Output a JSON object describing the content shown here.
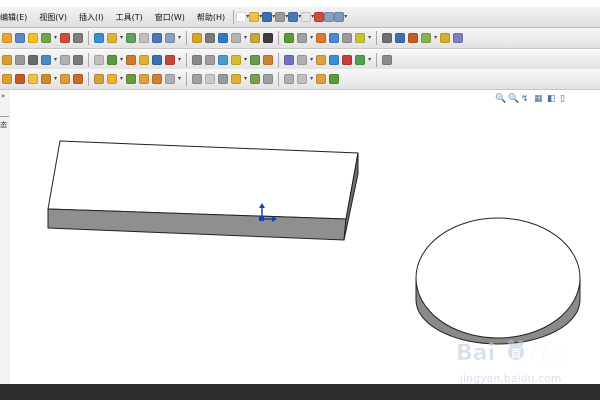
{
  "menubar": {
    "items": [
      "编辑(E)",
      "视图(V)",
      "插入(I)",
      "工具(T)",
      "窗口(W)",
      "帮助(H)"
    ]
  },
  "toolbar1": {
    "icons": [
      "#f0a030",
      "#5b87c7",
      "#f3c21b",
      "#6ea84a",
      "#d04a3a",
      "#7e7e7e",
      "#3a8fd0",
      "#e2b13a",
      "#60a060",
      "#c0c0c0",
      "#4a77b5",
      "#8aa0c0",
      "#d9a32a",
      "#7a7a7a",
      "#2e7cc0",
      "#b5b5b5",
      "#c8a73a",
      "#3c3c3c",
      "#5a9a3a",
      "#a0a0a0",
      "#d77a2a",
      "#4b8ad3",
      "#9b9b9b",
      "#c9c32e",
      "#6f6f6f",
      "#3a6fb0",
      "#c95a2a",
      "#8bb34a",
      "#d5b02e",
      "#8080c0"
    ]
  },
  "toolbar2": {
    "icons": [
      "#d8a02a",
      "#9a9a9a",
      "#6a6a6a",
      "#4a8bc5",
      "#b0b0b0",
      "#7a7a7a",
      "#c0c0c0",
      "#5a9a3a",
      "#d07a2a",
      "#e0b030",
      "#3a6fb0",
      "#c04a3a",
      "#8a8a8a",
      "#a0a0a0",
      "#4b9bd3",
      "#d0c030",
      "#6a9a4a",
      "#d08030",
      "#7070c0",
      "#b0b0b0",
      "#e0a040",
      "#3a8fd0",
      "#c04040",
      "#50a050",
      "#8c8c8c"
    ]
  },
  "toolbar3": {
    "icons": [
      "#e0a030",
      "#c05a2a",
      "#f0c040",
      "#d08a2a",
      "#e09a3a",
      "#c86a2a",
      "#d4a03a",
      "#f0b030",
      "#6a9a3a",
      "#e0a040",
      "#d08030",
      "#b0b0b0",
      "#a0a0a0",
      "#c9c9c9",
      "#9a9a9a",
      "#e0b030",
      "#7aa04a",
      "#a0a0a0",
      "#b0b0b0",
      "#c0c0c0",
      "#e0a040",
      "#5a9a3a"
    ]
  },
  "leftpanel": {
    "arrow": "»",
    "text": "态"
  },
  "viewicons": [
    "🔍",
    "🔍",
    "↯",
    "▦",
    "◧",
    "▯"
  ],
  "watermark": {
    "brand_latin": "Bai",
    "brand_du": "百",
    "brand_suffix": "经验",
    "url": "jingyan.baidu.com"
  },
  "colors": {
    "box_top": "#ffffff",
    "box_front": "#8f8f8f",
    "box_end": "#6e6e6e",
    "axis": "#1a3fb0",
    "cylinder_side": "#8a8a8a"
  }
}
